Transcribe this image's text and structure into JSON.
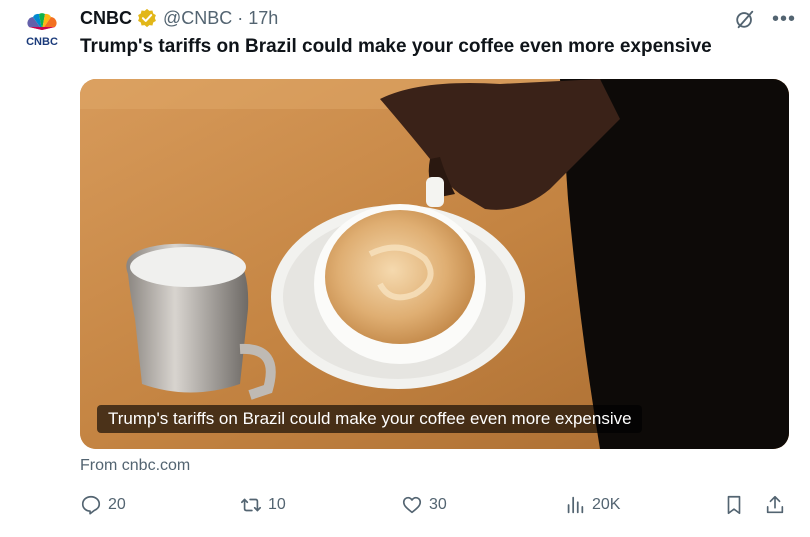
{
  "author": {
    "name": "CNBC",
    "handle": "@CNBC",
    "separator": "·",
    "time": "17h",
    "logo_text": "CNBC"
  },
  "tweet": {
    "text": "Trump's tariffs on Brazil could make your coffee even more expensive"
  },
  "card": {
    "caption": "Trump's tariffs on Brazil could make your coffee even more expensive",
    "source": "From cnbc.com"
  },
  "actions": {
    "replies": "20",
    "reposts": "10",
    "likes": "30",
    "views": "20K"
  },
  "colors": {
    "text_primary": "#0f1419",
    "text_secondary": "#536471",
    "verified_gold": "#e2b719"
  },
  "icons": [
    "cnbc-peacock-logo",
    "verified-badge-icon",
    "grok-icon",
    "more-icon",
    "reply-icon",
    "repost-icon",
    "like-icon",
    "views-icon",
    "bookmark-icon",
    "share-icon"
  ]
}
